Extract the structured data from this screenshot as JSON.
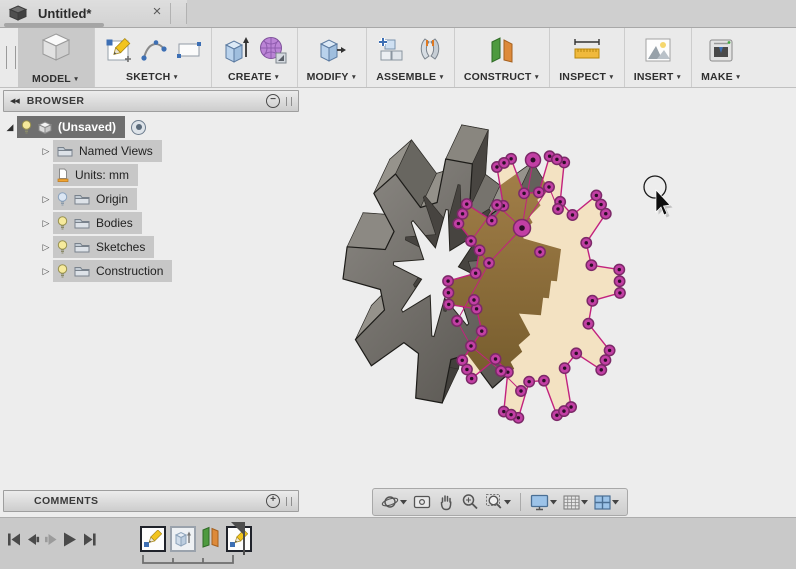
{
  "window": {
    "tab_title": "Untitled*",
    "close_glyph": "×"
  },
  "toolbar": {
    "dropdown_glyph": "▼",
    "model_label": "MODEL",
    "sketch_label": "SKETCH",
    "create_label": "CREATE",
    "modify_label": "MODIFY",
    "assemble_label": "ASSEMBLE",
    "construct_label": "CONSTRUCT",
    "inspect_label": "INSPECT",
    "insert_label": "INSERT",
    "make_label": "MAKE"
  },
  "browser": {
    "header_label": "BROWSER",
    "collapse_glyph": "◀◀",
    "toggle_glyph": "−",
    "root_label": "(Unsaved)",
    "rows": [
      {
        "label": "Named Views"
      },
      {
        "label": "Units: mm"
      },
      {
        "label": "Origin"
      },
      {
        "label": "Bodies"
      },
      {
        "label": "Sketches"
      },
      {
        "label": "Construction"
      }
    ]
  },
  "comments": {
    "header_label": "COMMENTS",
    "add_glyph": "+"
  },
  "canvas": {
    "colors": {
      "background": "#ededed",
      "body_light": "#8d8a85",
      "body_dark": "#514e49",
      "body_back": "#8a8781",
      "body_outline": "#1d1c19",
      "sketch_fill": "#f3e2c2",
      "sketch_line": "#c2227e",
      "point_fill": "#c23fa4",
      "point_ring": "#7c2968",
      "point_dot": "#2c0e27",
      "overlap_light": "#a5814a",
      "overlap_dark": "#6e5628"
    }
  }
}
